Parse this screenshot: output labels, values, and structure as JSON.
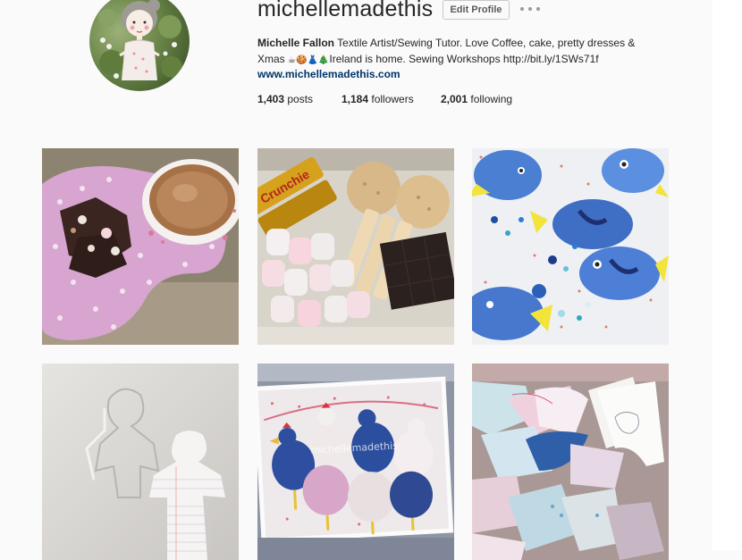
{
  "profile": {
    "username": "michellemadethis",
    "edit_label": "Edit Profile",
    "full_name": "Michelle Fallon",
    "bio_line1": "Textile Artist/Sewing Tutor. Love Coffee, cake, pretty dresses &",
    "bio_line2_prefix": "Xmas",
    "bio_emojis": "☕🍪👗🎄",
    "bio_line2_rest": "Ireland is home. Sewing Workshops http://bit.ly/1SWs71f",
    "website": "www.michellemadethis.com"
  },
  "stats": {
    "posts_count": "1,403",
    "posts_label": "posts",
    "followers_count": "1,184",
    "followers_label": "followers",
    "following_count": "2,001",
    "following_label": "following"
  },
  "posts": [
    {
      "subject": "coffee cup with chocolate rocky road on pink polka dot plate"
    },
    {
      "subject": "Crunchie bars, marshmallows, shortbread fingers and chocolate"
    },
    {
      "subject": "blue fabric fish plush toys with buttons"
    },
    {
      "subject": "paper doll sewing pattern pieces"
    },
    {
      "subject": "fabric chicken decorations on ribbon"
    },
    {
      "subject": "fabric scraps and pattern tracings"
    }
  ],
  "watermark": "michellemadethis",
  "colors": {
    "link": "#003569",
    "background": "#fafafa"
  }
}
